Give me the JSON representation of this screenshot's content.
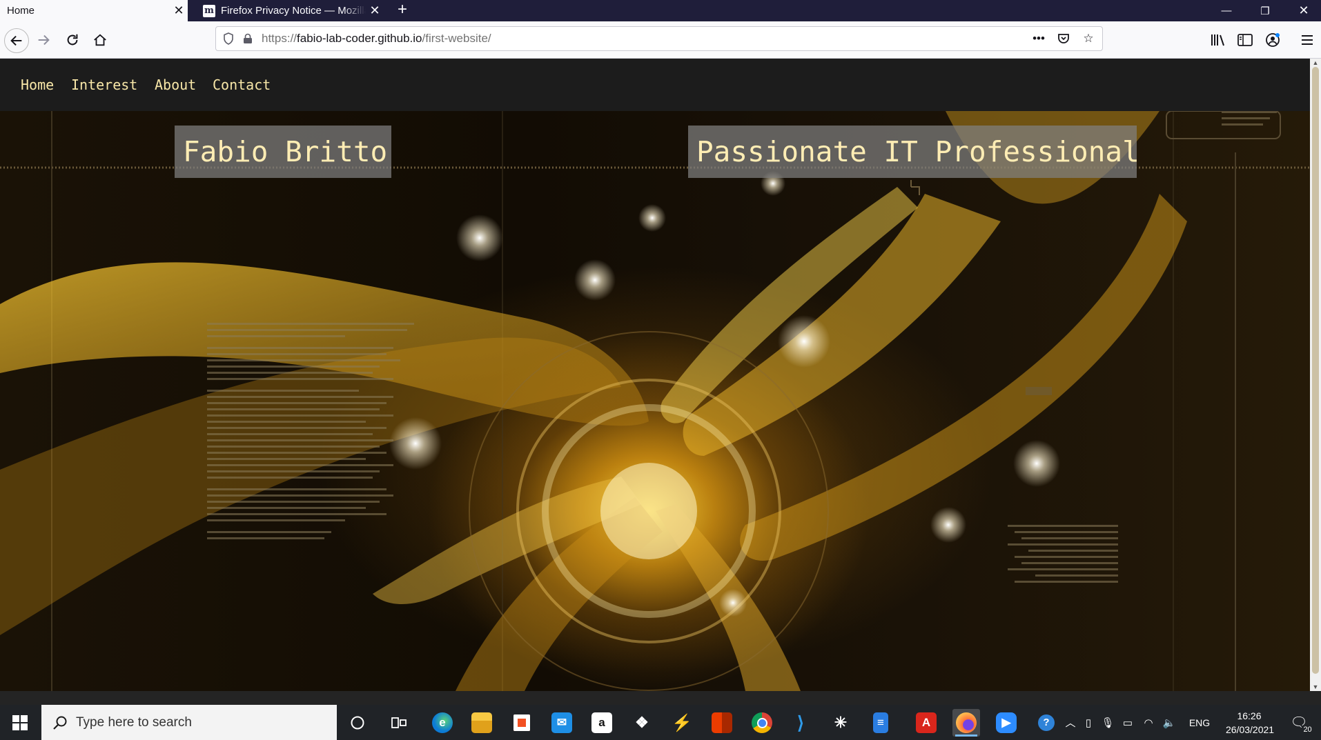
{
  "browser": {
    "tabs": [
      {
        "label": "Home",
        "active": true
      },
      {
        "label": "Firefox Privacy Notice — Mozilla",
        "favicon": "m",
        "active": false
      }
    ],
    "url": {
      "scheme": "https://",
      "host": "fabio-lab-coder.github.io",
      "path": "/first-website/"
    },
    "toolbar_icons": [
      "library-icon",
      "sidebar-icon",
      "account-icon",
      "menu-icon"
    ]
  },
  "site": {
    "nav": [
      "Home",
      "Interest",
      "About",
      "Contact"
    ],
    "name": "Fabio Britto",
    "tagline": "Passionate IT Professional",
    "accent_color": "#f8e7a8"
  },
  "taskbar": {
    "search_placeholder": "Type here to search",
    "tray_lang": "ENG",
    "time": "16:26",
    "date": "26/03/2021",
    "notification_count": "20",
    "pinned_apps": [
      "cortana",
      "task-view",
      "edge",
      "file-explorer",
      "store",
      "mail",
      "amazon",
      "dropbox",
      "vivaldi",
      "office",
      "chrome",
      "vscode",
      "slack",
      "notepad",
      "acrobat",
      "firefox",
      "zoom"
    ]
  }
}
